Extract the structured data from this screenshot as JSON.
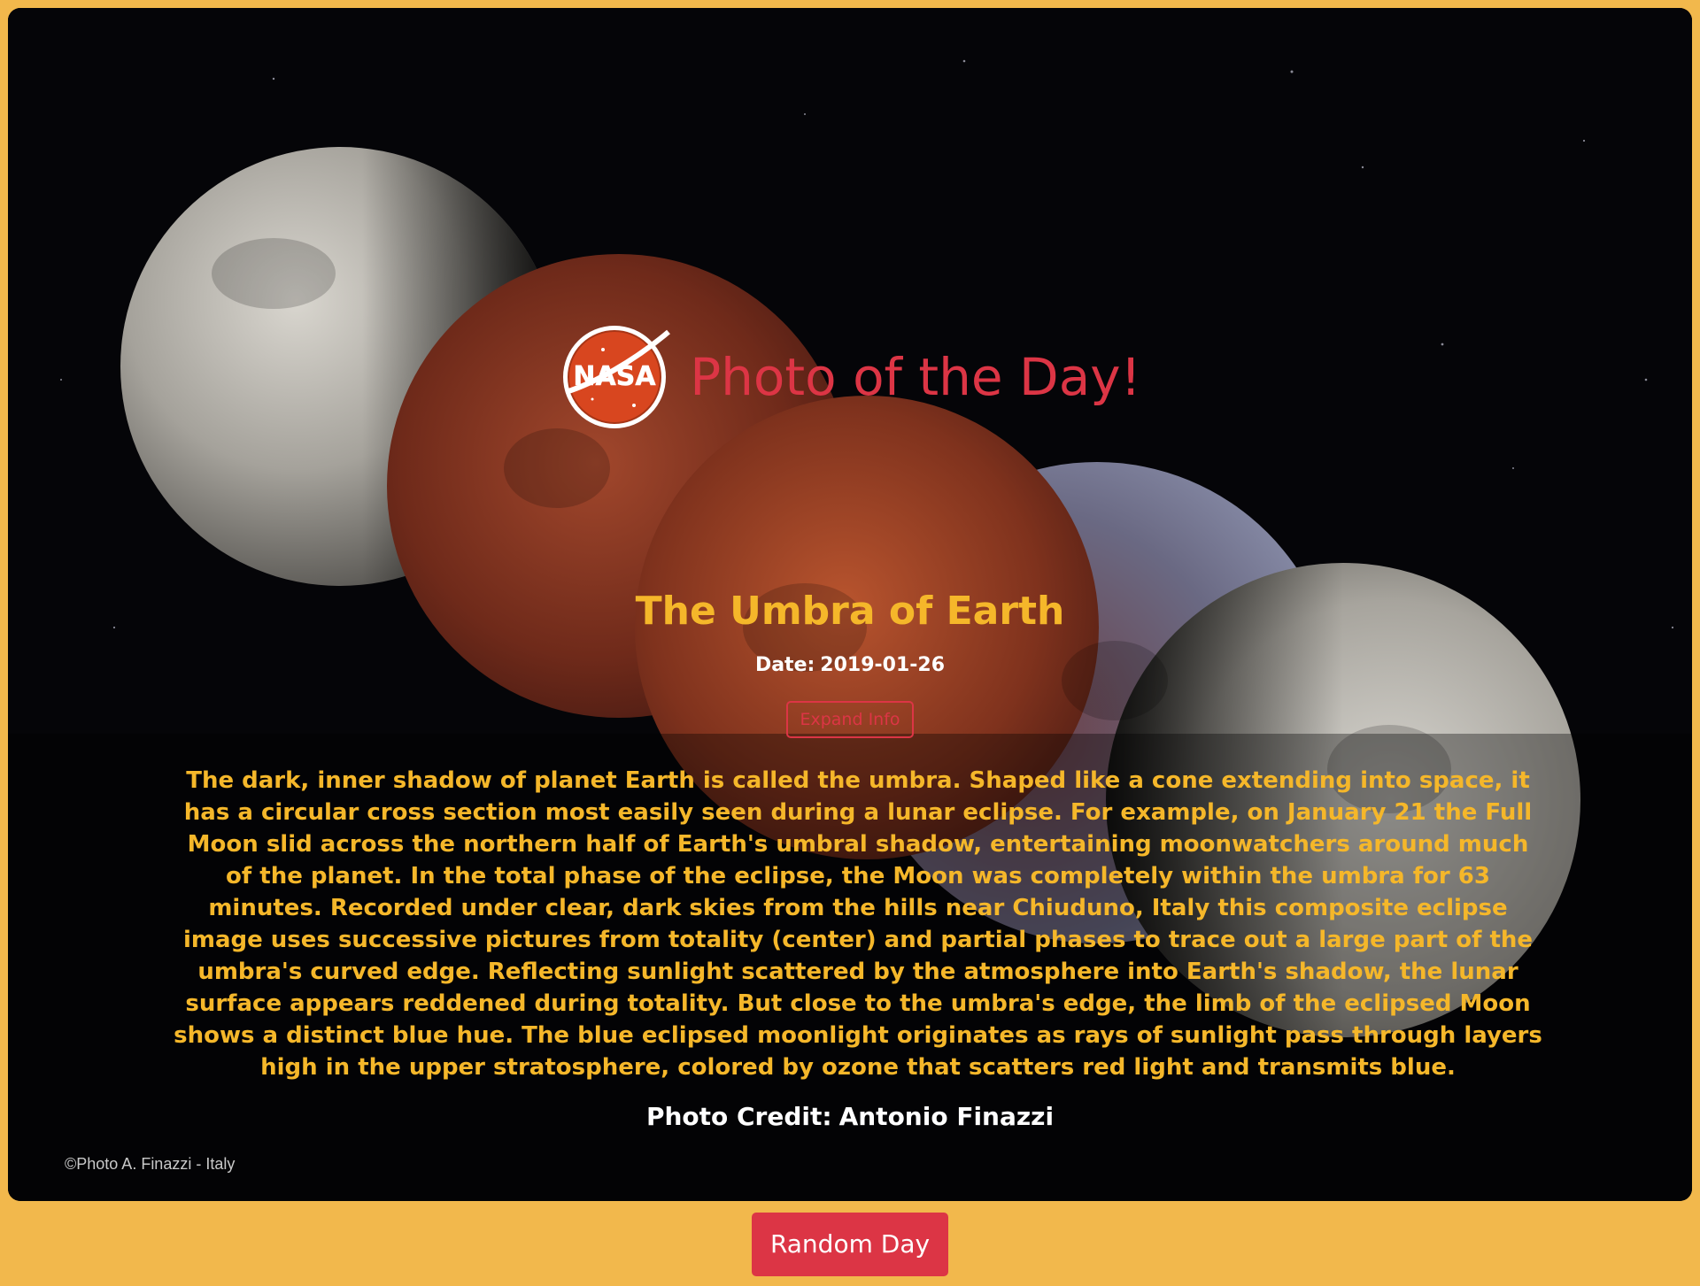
{
  "header": {
    "title": "Photo of the Day!",
    "logo_text": "NASA"
  },
  "apod": {
    "title": "The Umbra of Earth",
    "date_label": "Date:",
    "date": "2019-01-26",
    "expand_label": "Expand Info",
    "explanation": "The dark, inner shadow of planet Earth is called the umbra. Shaped like a cone extending into space, it has a circular cross section most easily seen during a lunar eclipse. For example, on January 21 the Full Moon slid across the northern half of Earth's umbral shadow, entertaining moonwatchers around much of the planet. In the total phase of the eclipse, the Moon was completely within the umbra for 63 minutes. Recorded under clear, dark skies from the hills near Chiuduno, Italy this composite eclipse image uses successive pictures from totality (center) and partial phases to trace out a large part of the umbra's curved edge. Reflecting sunlight scattered by the atmosphere into Earth's shadow, the lunar surface appears reddened during totality. But close to the umbra's edge, the limb of the eclipsed Moon shows a distinct blue hue. The blue eclipsed moonlight originates as rays of sunlight pass through layers high in the upper stratosphere, colored by ozone that scatters red light and transmits blue.",
    "credit_label": "Photo Credit:",
    "credit": "Antonio Finazzi",
    "watermark": "©Photo A. Finazzi - Italy"
  },
  "footer": {
    "random_label": "Random Day"
  },
  "colors": {
    "page_bg": "#f2b84c",
    "accent_red": "#dc3545",
    "text_gold": "#f5b72a"
  }
}
